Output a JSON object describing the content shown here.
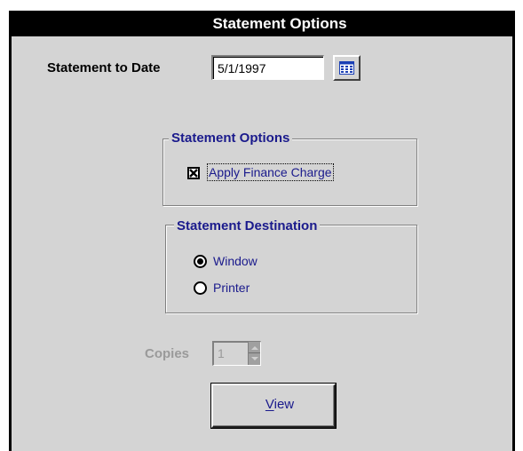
{
  "window": {
    "title": "Statement Options"
  },
  "statement_date": {
    "label": "Statement to Date",
    "value": "5/1/1997",
    "calendar_icon": "calendar-icon"
  },
  "options_group": {
    "title": "Statement Options",
    "apply_finance_charge": {
      "label": "Apply Finance Charge",
      "checked": true
    }
  },
  "destination_group": {
    "title": "Statement Destination",
    "options": [
      {
        "label": "Window",
        "selected": true
      },
      {
        "label": "Printer",
        "selected": false
      }
    ]
  },
  "copies": {
    "label": "Copies",
    "value": "1",
    "enabled": false
  },
  "view_button": {
    "label": "View",
    "accelerator": "V"
  },
  "colors": {
    "title_bar": "#000000",
    "title_text": "#ffffff",
    "dialog_bg": "#d4d4d4",
    "group_text": "#1a1a8c",
    "disabled_text": "#9a9a9a",
    "calendar_accent": "#1a3fb5"
  }
}
